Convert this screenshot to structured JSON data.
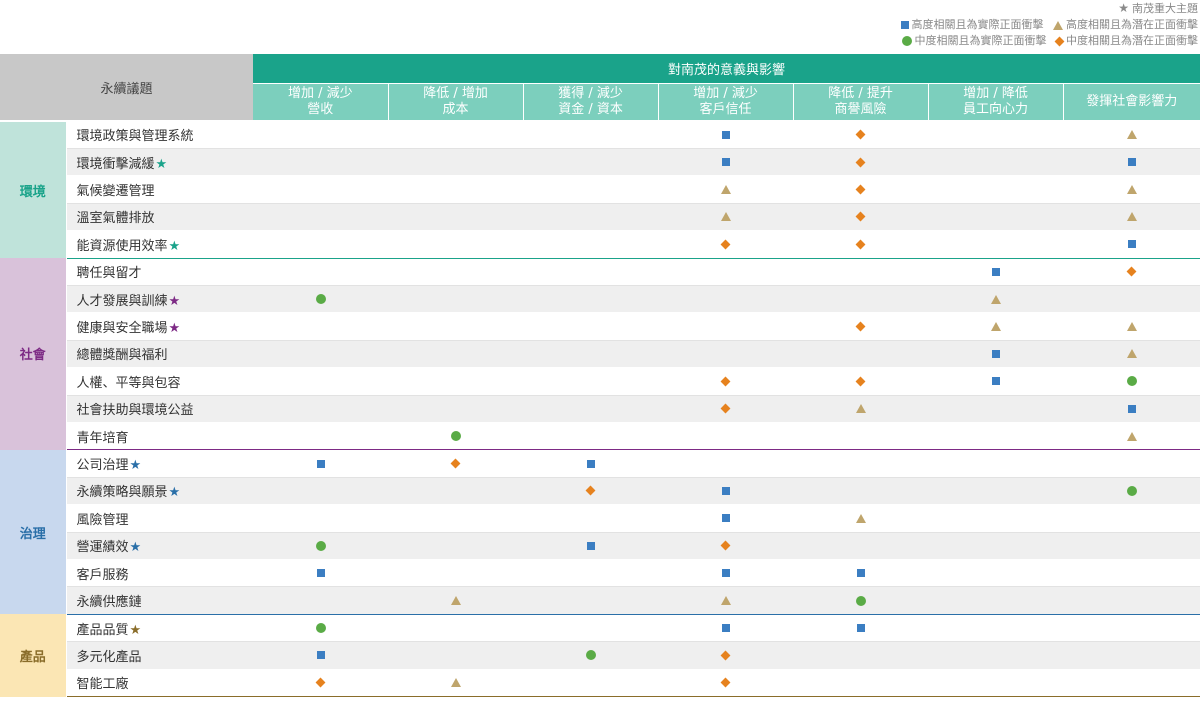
{
  "legend": {
    "star": "南茂重大主題",
    "high_actual": "高度相關且為實際正面衝擊",
    "high_potential": "高度相關且為潛在正面衝擊",
    "mid_actual": "中度相關且為實際正面衝擊",
    "mid_potential": "中度相關且為潛在正面衝擊"
  },
  "header": {
    "topic": "永續議題",
    "group": "對南茂的意義與影響",
    "columns": [
      {
        "line1": "增加 / 減少",
        "line2": "營收"
      },
      {
        "line1": "降低 / 增加",
        "line2": "成本"
      },
      {
        "line1": "獲得 / 減少",
        "line2": "資金 / 資本"
      },
      {
        "line1": "增加 / 減少",
        "line2": "客戶信任"
      },
      {
        "line1": "降低 / 提升",
        "line2": "商譽風險"
      },
      {
        "line1": "增加 / 降低",
        "line2": "員工向心力"
      },
      {
        "line1": "發揮社會影響力",
        "line2": ""
      }
    ]
  },
  "colors": {
    "environment": "#1aa38a",
    "society": "#7d2a85",
    "governance": "#2a6fa8",
    "product": "#8a6d2a",
    "high_actual": "#3b7ec2",
    "high_potential": "#bfa56c",
    "mid_actual": "#5aab46",
    "mid_potential": "#e6821e"
  },
  "marker_icons": {
    "S": "blue-square-icon",
    "T": "tan-triangle-icon",
    "C": "green-circle-icon",
    "D": "orange-diamond-icon"
  },
  "categories": [
    {
      "label": "環境",
      "key": "environment",
      "bg": "#bfe3da",
      "rows": [
        {
          "name": "環境政策與管理系統",
          "star": false,
          "marks": [
            "",
            "",
            "",
            "S",
            "D",
            "",
            "T"
          ]
        },
        {
          "name": "環境衝擊減緩",
          "star": true,
          "marks": [
            "",
            "",
            "",
            "S",
            "D",
            "",
            "S"
          ]
        },
        {
          "name": "氣候變遷管理",
          "star": false,
          "marks": [
            "",
            "",
            "",
            "T",
            "D",
            "",
            "T"
          ]
        },
        {
          "name": "溫室氣體排放",
          "star": false,
          "marks": [
            "",
            "",
            "",
            "T",
            "D",
            "",
            "T"
          ]
        },
        {
          "name": "能資源使用效率",
          "star": true,
          "marks": [
            "",
            "",
            "",
            "D",
            "D",
            "",
            "S"
          ]
        }
      ]
    },
    {
      "label": "社會",
      "key": "society",
      "bg": "#d9c2da",
      "rows": [
        {
          "name": "聘任與留才",
          "star": false,
          "marks": [
            "",
            "",
            "",
            "",
            "",
            "S",
            "D"
          ]
        },
        {
          "name": "人才發展與訓練",
          "star": true,
          "marks": [
            "C",
            "",
            "",
            "",
            "",
            "T",
            ""
          ]
        },
        {
          "name": "健康與安全職場",
          "star": true,
          "marks": [
            "",
            "",
            "",
            "",
            "D",
            "T",
            "T"
          ]
        },
        {
          "name": "總體獎酬與福利",
          "star": false,
          "marks": [
            "",
            "",
            "",
            "",
            "",
            "S",
            "T"
          ]
        },
        {
          "name": "人權、平等與包容",
          "star": false,
          "marks": [
            "",
            "",
            "",
            "D",
            "D",
            "S",
            "C"
          ]
        },
        {
          "name": "社會扶助與環境公益",
          "star": false,
          "marks": [
            "",
            "",
            "",
            "D",
            "T",
            "",
            "S"
          ]
        },
        {
          "name": "青年培育",
          "star": false,
          "marks": [
            "",
            "C",
            "",
            "",
            "",
            "",
            "T"
          ]
        }
      ]
    },
    {
      "label": "治理",
      "key": "governance",
      "bg": "#c8d8ee",
      "rows": [
        {
          "name": "公司治理",
          "star": true,
          "marks": [
            "S",
            "D",
            "S",
            "",
            "",
            "",
            ""
          ]
        },
        {
          "name": "永續策略與願景",
          "star": true,
          "marks": [
            "",
            "",
            "D",
            "S",
            "",
            "",
            "C"
          ]
        },
        {
          "name": "風險管理",
          "star": false,
          "marks": [
            "",
            "",
            "",
            "S",
            "T",
            "",
            ""
          ]
        },
        {
          "name": "營運績效",
          "star": true,
          "marks": [
            "C",
            "",
            "S",
            "D",
            "",
            "",
            ""
          ]
        },
        {
          "name": "客戶服務",
          "star": false,
          "marks": [
            "S",
            "",
            "",
            "S",
            "S",
            "",
            ""
          ]
        },
        {
          "name": "永續供應鏈",
          "star": false,
          "marks": [
            "",
            "T",
            "",
            "T",
            "C",
            "",
            ""
          ]
        }
      ]
    },
    {
      "label": "產品",
      "key": "product",
      "bg": "#fbe6b4",
      "rows": [
        {
          "name": "產品品質",
          "star": true,
          "marks": [
            "C",
            "",
            "",
            "S",
            "S",
            "",
            ""
          ]
        },
        {
          "name": "多元化產品",
          "star": false,
          "marks": [
            "S",
            "",
            "C",
            "D",
            "",
            "",
            ""
          ]
        },
        {
          "name": "智能工廠",
          "star": false,
          "marks": [
            "D",
            "T",
            "",
            "D",
            "",
            "",
            ""
          ]
        }
      ]
    }
  ]
}
